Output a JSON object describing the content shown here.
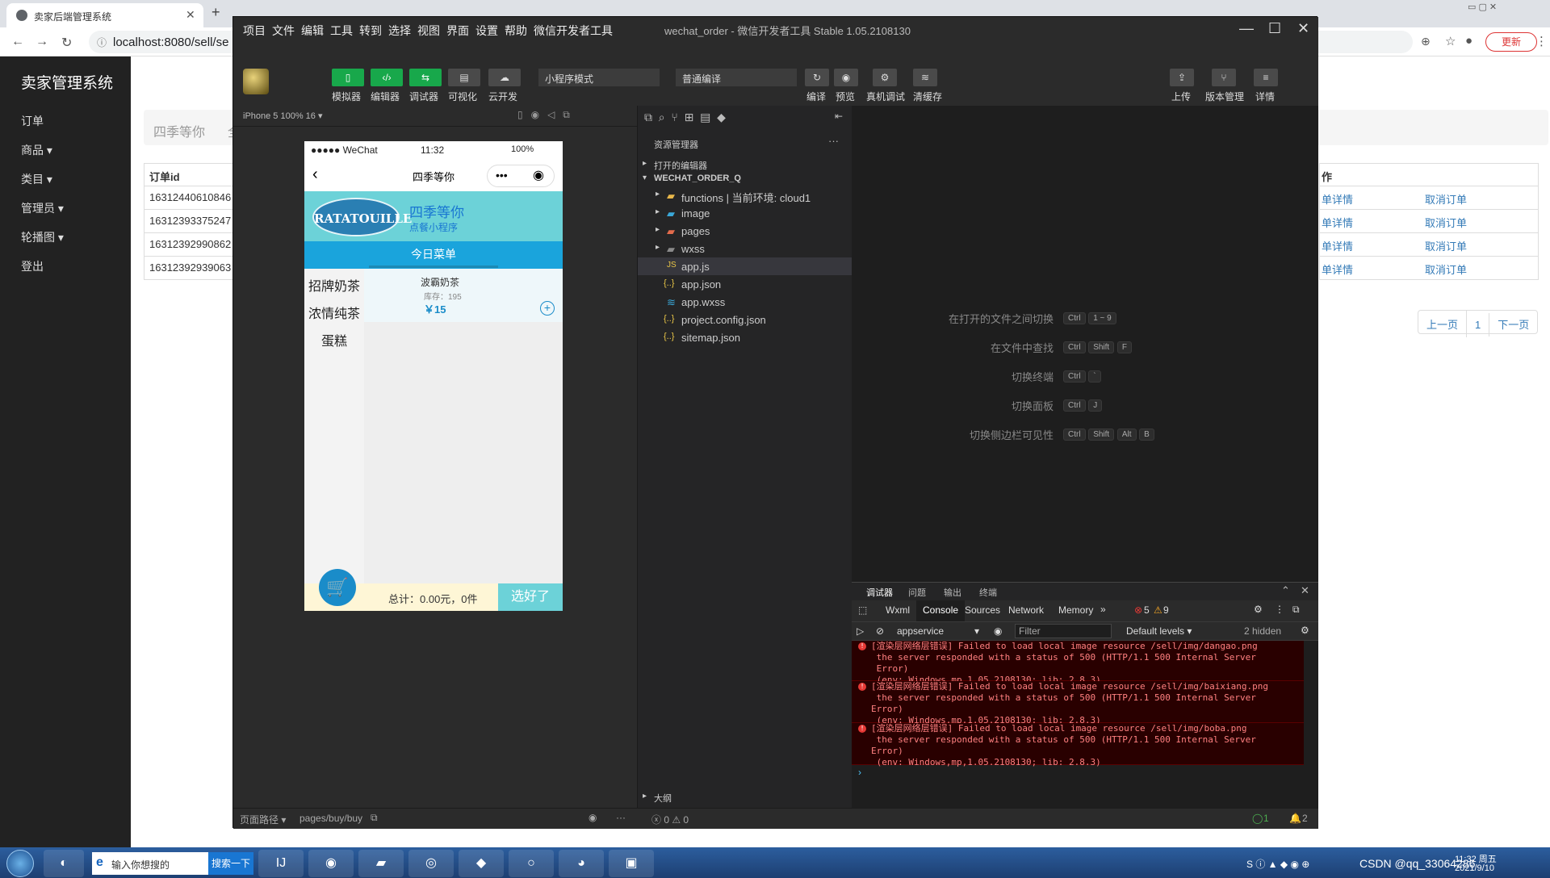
{
  "browser": {
    "tab_title": "卖家后端管理系统",
    "url": "localhost:8080/sell/se",
    "update_label": "更新"
  },
  "seller": {
    "brand": "卖家管理系统",
    "nav": [
      "订单",
      "商品 ▾",
      "类目 ▾",
      "管理员 ▾",
      "轮播图 ▾",
      "登出"
    ],
    "breadcrumb": "四季等你",
    "breadcrumb_extra": "全",
    "table_header": "订单id",
    "order_ids": [
      "16312440610846",
      "16312393375247",
      "16312392990862",
      "16312392939063"
    ],
    "action_header": "作",
    "actions": [
      {
        "detail": "单详情",
        "cancel": "取消订单"
      },
      {
        "detail": "单详情",
        "cancel": "取消订单"
      },
      {
        "detail": "单详情",
        "cancel": "取消订单"
      },
      {
        "detail": "单详情",
        "cancel": "取消订单"
      }
    ],
    "pager": [
      "上一页",
      "1",
      "下一页"
    ]
  },
  "devtools": {
    "menu": [
      "项目",
      "文件",
      "编辑",
      "工具",
      "转到",
      "选择",
      "视图",
      "界面",
      "设置",
      "帮助",
      "微信开发者工具"
    ],
    "window_title": "wechat_order - 微信开发者工具 Stable 1.05.2108130",
    "toolbar": {
      "simulator": "模拟器",
      "editor": "编辑器",
      "debugger": "调试器",
      "visual": "可视化",
      "cloud": "云开发",
      "mode": "小程序模式",
      "compile_mode": "普通编译",
      "compile": "编译",
      "preview": "预览",
      "real_debug": "真机调试",
      "clear_cache": "清缓存",
      "upload": "上传",
      "version": "版本管理",
      "details": "详情"
    },
    "device": "iPhone 5 100% 16 ▾",
    "phone": {
      "carrier": "●●●●● WeChat",
      "time": "11:32",
      "battery": "100%",
      "nav_title": "四季等你",
      "shop_name": "四季等你",
      "shop_sub": "点餐小程序",
      "logo_text": "RATATOUILLE",
      "today_menu": "今日菜单",
      "categories": [
        "招牌奶茶",
        "浓情纯茶",
        "蛋糕"
      ],
      "food_name": "波霸奶茶",
      "food_stock": "库存：195",
      "food_price": "￥15",
      "total": "总计：0.00元，0件",
      "checkout": "选好了"
    },
    "explorer": {
      "title": "资源管理器",
      "open_editors": "打开的编辑器",
      "project": "WECHAT_ORDER_Q",
      "files": [
        {
          "name": "functions | 当前环境: cloud1",
          "icon": "folder-icon"
        },
        {
          "name": "image",
          "icon": "folder-icon"
        },
        {
          "name": "pages",
          "icon": "folder-icon"
        },
        {
          "name": "wxss",
          "icon": "folder-icon"
        },
        {
          "name": "app.js",
          "icon": "js-icon"
        },
        {
          "name": "app.json",
          "icon": "json-icon"
        },
        {
          "name": "app.wxss",
          "icon": "wxss-icon"
        },
        {
          "name": "project.config.json",
          "icon": "json-icon"
        },
        {
          "name": "sitemap.json",
          "icon": "json-icon"
        }
      ],
      "outline": "大纲"
    },
    "shortcuts": [
      {
        "label": "在打开的文件之间切换",
        "keys": [
          "Ctrl",
          "1 ~ 9"
        ]
      },
      {
        "label": "在文件中查找",
        "keys": [
          "Ctrl",
          "Shift",
          "F"
        ]
      },
      {
        "label": "切换终端",
        "keys": [
          "Ctrl",
          "`"
        ]
      },
      {
        "label": "切换面板",
        "keys": [
          "Ctrl",
          "J"
        ]
      },
      {
        "label": "切换侧边栏可见性",
        "keys": [
          "Ctrl",
          "Shift",
          "Alt",
          "B"
        ]
      }
    ],
    "console": {
      "panel_tabs": [
        "调试器",
        "问题",
        "输出",
        "终端"
      ],
      "tabs": [
        "Wxml",
        "Console",
        "Sources",
        "Network",
        "Memory"
      ],
      "errors": "5",
      "warnings": "9",
      "context": "appservice",
      "filter": "Filter",
      "levels": "Default levels ▾",
      "hidden": "2 hidden",
      "messages": [
        "[渲染层网络层错误] Failed to load local image resource /sell/img/dangao.png\n the server responded with a status of 500 (HTTP/1.1 500 Internal Server\n Error)\n (env: Windows,mp,1.05.2108130; lib: 2.8.3)",
        "[渲染层网络层错误] Failed to load local image resource /sell/img/baixiang.png\n the server responded with a status of 500 (HTTP/1.1 500 Internal Server\nError)\n (env: Windows,mp,1.05.2108130; lib: 2.8.3)",
        "[渲染层网络层错误] Failed to load local image resource /sell/img/boba.png\n the server responded with a status of 500 (HTTP/1.1 500 Internal Server\nError)\n (env: Windows,mp,1.05.2108130; lib: 2.8.3)"
      ]
    },
    "status": {
      "page_path_label": "页面路径 ▾",
      "page_path": "pages/buy/buy",
      "problems": "ⓧ 0 ⚠ 0",
      "right1": "1",
      "right2": "2"
    }
  },
  "taskbar": {
    "search_text": "输入你想搜的",
    "search_btn": "搜索一下",
    "tray_text": "CSDN @qq_33064286",
    "clock_time": "11:32 周五",
    "clock_date": "2021/9/10"
  }
}
